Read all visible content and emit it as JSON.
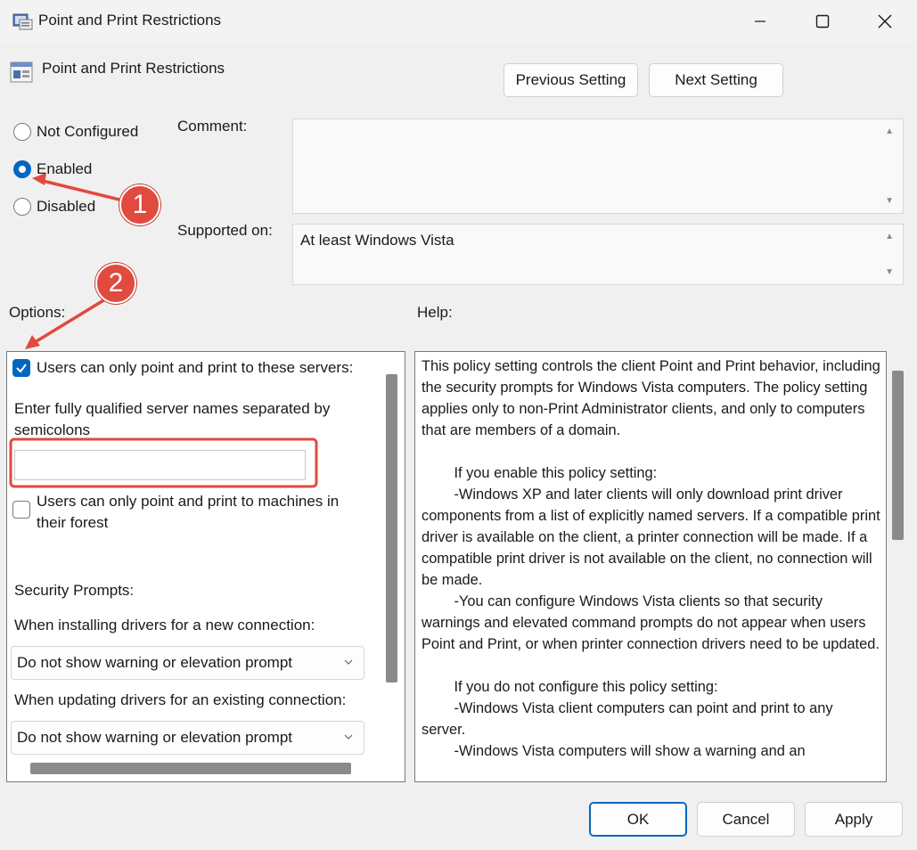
{
  "window": {
    "title": "Point and Print Restrictions"
  },
  "header": {
    "title": "Point and Print Restrictions",
    "prev_label": "Previous Setting",
    "next_label": "Next Setting"
  },
  "state": {
    "options": [
      "Not Configured",
      "Enabled",
      "Disabled"
    ],
    "selected": "Enabled"
  },
  "comment": {
    "label": "Comment:",
    "value": ""
  },
  "supported": {
    "label": "Supported on:",
    "value": "At least Windows Vista"
  },
  "options_panel": {
    "label": "Options:",
    "checkbox1": {
      "label": "Users can only point and print to these servers:",
      "checked": true
    },
    "server_label": "Enter fully qualified server names separated by semicolons",
    "server_value": "",
    "checkbox2": {
      "label": "Users can only point and print to machines in their forest",
      "checked": false
    },
    "security_label": "Security Prompts:",
    "install_label": "When installing drivers for a new connection:",
    "install_value": "Do not show warning or elevation prompt",
    "update_label": "When updating drivers for an existing connection:",
    "update_value": "Do not show warning or elevation prompt"
  },
  "help": {
    "label": "Help:",
    "text": "This policy setting controls the client Point and Print behavior, including the security prompts for Windows Vista computers. The policy setting applies only to non-Print Administrator clients, and only to computers that are members of a domain.\n\n        If you enable this policy setting:\n        -Windows XP and later clients will only download print driver components from a list of explicitly named servers. If a compatible print driver is available on the client, a printer connection will be made. If a compatible print driver is not available on the client, no connection will be made.\n        -You can configure Windows Vista clients so that security warnings and elevated command prompts do not appear when users Point and Print, or when printer connection drivers need to be updated.\n\n        If you do not configure this policy setting:\n        -Windows Vista client computers can point and print to any server.\n        -Windows Vista computers will show a warning and an"
  },
  "buttons": {
    "ok": "OK",
    "cancel": "Cancel",
    "apply": "Apply"
  },
  "annotations": {
    "badge1": "1",
    "badge2": "2",
    "color": "#e04a3f"
  },
  "colors": {
    "accent": "#0067c0",
    "background": "#f0f0f0"
  }
}
